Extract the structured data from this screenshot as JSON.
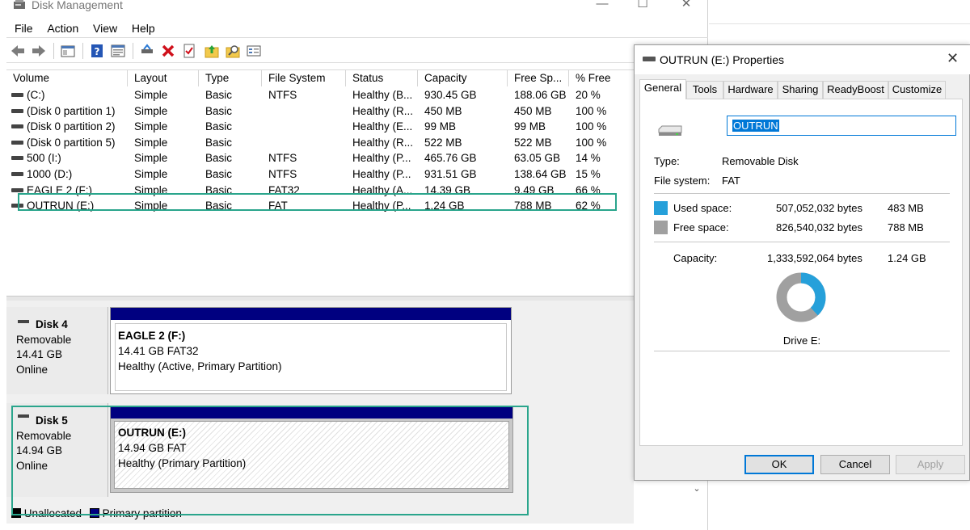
{
  "disk_management": {
    "title": "Disk Management",
    "menu": [
      "File",
      "Action",
      "View",
      "Help"
    ],
    "columns": [
      "Volume",
      "Layout",
      "Type",
      "File System",
      "Status",
      "Capacity",
      "Free Sp...",
      "% Free"
    ],
    "rows": [
      {
        "volume": "(C:)",
        "layout": "Simple",
        "type": "Basic",
        "fs": "NTFS",
        "status": "Healthy (B...",
        "capacity": "930.45 GB",
        "free": "188.06 GB",
        "pct": "20 %"
      },
      {
        "volume": "(Disk 0 partition 1)",
        "layout": "Simple",
        "type": "Basic",
        "fs": "",
        "status": "Healthy (R...",
        "capacity": "450 MB",
        "free": "450 MB",
        "pct": "100 %"
      },
      {
        "volume": "(Disk 0 partition 2)",
        "layout": "Simple",
        "type": "Basic",
        "fs": "",
        "status": "Healthy (E...",
        "capacity": "99 MB",
        "free": "99 MB",
        "pct": "100 %"
      },
      {
        "volume": "(Disk 0 partition 5)",
        "layout": "Simple",
        "type": "Basic",
        "fs": "",
        "status": "Healthy (R...",
        "capacity": "522 MB",
        "free": "522 MB",
        "pct": "100 %"
      },
      {
        "volume": "500 (I:)",
        "layout": "Simple",
        "type": "Basic",
        "fs": "NTFS",
        "status": "Healthy (P...",
        "capacity": "465.76 GB",
        "free": "63.05 GB",
        "pct": "14 %"
      },
      {
        "volume": "1000 (D:)",
        "layout": "Simple",
        "type": "Basic",
        "fs": "NTFS",
        "status": "Healthy (P...",
        "capacity": "931.51 GB",
        "free": "138.64 GB",
        "pct": "15 %"
      },
      {
        "volume": "EAGLE 2 (F:)",
        "layout": "Simple",
        "type": "Basic",
        "fs": "FAT32",
        "status": "Healthy (A...",
        "capacity": "14.39 GB",
        "free": "9.49 GB",
        "pct": "66 %"
      },
      {
        "volume": "OUTRUN (E:)",
        "layout": "Simple",
        "type": "Basic",
        "fs": "FAT",
        "status": "Healthy (P...",
        "capacity": "1.24 GB",
        "free": "788 MB",
        "pct": "62 %"
      }
    ],
    "disks": [
      {
        "name": "Disk 4",
        "kind": "Removable",
        "size": "14.41 GB",
        "state": "Online",
        "partition": {
          "name": "EAGLE 2  (F:)",
          "detail": "14.41 GB FAT32",
          "status": "Healthy (Active, Primary Partition)"
        }
      },
      {
        "name": "Disk 5",
        "kind": "Removable",
        "size": "14.94 GB",
        "state": "Online",
        "partition": {
          "name": "OUTRUN  (E:)",
          "detail": "14.94 GB FAT",
          "status": "Healthy (Primary Partition)"
        }
      }
    ],
    "legend": {
      "unallocated": "Unallocated",
      "primary": "Primary partition"
    }
  },
  "properties": {
    "title": "OUTRUN (E:) Properties",
    "tabs": [
      "General",
      "Tools",
      "Hardware",
      "Sharing",
      "ReadyBoost",
      "Customize"
    ],
    "volume_name": "OUTRUN",
    "type_label": "Type:",
    "type_value": "Removable Disk",
    "fs_label": "File system:",
    "fs_value": "FAT",
    "used_label": "Used space:",
    "used_bytes": "507,052,032 bytes",
    "used_size": "483 MB",
    "free_label": "Free space:",
    "free_bytes": "826,540,032 bytes",
    "free_size": "788 MB",
    "capacity_label": "Capacity:",
    "capacity_bytes": "1,333,592,064 bytes",
    "capacity_size": "1.24 GB",
    "drive_label": "Drive E:",
    "used_fraction": 0.38,
    "buttons": {
      "ok": "OK",
      "cancel": "Cancel",
      "apply": "Apply"
    }
  },
  "colors": {
    "used": "#26a0da",
    "free": "#a0a0a0",
    "highlight": "#2aa58c",
    "partition_bar": "#000080"
  }
}
